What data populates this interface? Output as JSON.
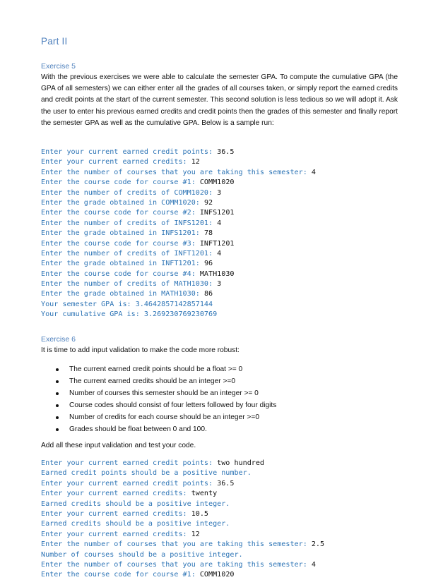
{
  "document": {
    "part_title": "Part II",
    "exercise5": {
      "title": "Exercise 5",
      "paragraph": "With the previous exercises we were able to calculate the semester GPA. To compute the cumulative GPA (the GPA of all semesters) we can either enter all the grades of all courses taken, or simply report the earned credits and credit points at the start of the current semester. This second solution is less tedious so we will adopt it. Ask the user to enter his previous earned credits and credit points then the grades of this semester and finally report the semester GPA as well as the cumulative GPA. Below is a sample run:",
      "sample_run": [
        {
          "prompt": "Enter your current earned credit points: ",
          "input": "36.5"
        },
        {
          "prompt": "Enter your current earned credits: ",
          "input": "12"
        },
        {
          "prompt": "Enter the number of courses that you are taking this semester: ",
          "input": "4"
        },
        {
          "prompt": "Enter the course code for course #1: ",
          "input": "COMM1020"
        },
        {
          "prompt": "Enter the number of credits of COMM1020: ",
          "input": "3"
        },
        {
          "prompt": "Enter the grade obtained in COMM1020: ",
          "input": "92"
        },
        {
          "prompt": "Enter the course code for course #2: ",
          "input": "INFS1201"
        },
        {
          "prompt": "Enter the number of credits of INFS1201: ",
          "input": "4"
        },
        {
          "prompt": "Enter the grade obtained in INFS1201: ",
          "input": "78"
        },
        {
          "prompt": "Enter the course code for course #3: ",
          "input": "INFT1201"
        },
        {
          "prompt": "Enter the number of credits of INFT1201: ",
          "input": "4"
        },
        {
          "prompt": "Enter the grade obtained in INFT1201: ",
          "input": "96"
        },
        {
          "prompt": "Enter the course code for course #4: ",
          "input": "MATH1030"
        },
        {
          "prompt": "Enter the number of credits of MATH1030: ",
          "input": "3"
        },
        {
          "prompt": "Enter the grade obtained in MATH1030: ",
          "input": "86"
        },
        {
          "prompt": "Your semester GPA is: 3.4642857142857144",
          "input": ""
        },
        {
          "prompt": "Your cumulative GPA is: 3.269230769230769",
          "input": ""
        }
      ]
    },
    "exercise6": {
      "title": "Exercise 6",
      "intro": "It is time to add input validation to make the code more robust:",
      "rules": [
        "The current earned credit points should be a float >= 0",
        "The current earned credits should be an integer >=0",
        "Number of courses this semester should be an integer >= 0",
        "Course codes should consist of four letters followed by four digits",
        "Number of credits for each course should be an integer >=0",
        "Grades should be float between 0 and 100."
      ],
      "instruction": "Add all these input validation and test your code.",
      "sample_run": [
        {
          "prompt": "Enter your current earned credit points: ",
          "input": "two hundred"
        },
        {
          "prompt": "Earned credit points should be a positive number.",
          "input": ""
        },
        {
          "prompt": "Enter your current earned credit points: ",
          "input": "36.5"
        },
        {
          "prompt": "Enter your current earned credits: ",
          "input": "twenty"
        },
        {
          "prompt": "Earned credits should be a positive integer.",
          "input": ""
        },
        {
          "prompt": "Enter your current earned credits: ",
          "input": "10.5"
        },
        {
          "prompt": "Earned credits should be a positive integer.",
          "input": ""
        },
        {
          "prompt": "Enter your current earned credits: ",
          "input": "12"
        },
        {
          "prompt": "Enter the number of courses that you are taking this semester: ",
          "input": "2.5"
        },
        {
          "prompt": "Number of courses should be a positive integer.",
          "input": ""
        },
        {
          "prompt": "Enter the number of courses that you are taking this semester: ",
          "input": "4"
        },
        {
          "prompt": "Enter the course code for course #1: ",
          "input": "COMM1020"
        }
      ]
    }
  }
}
